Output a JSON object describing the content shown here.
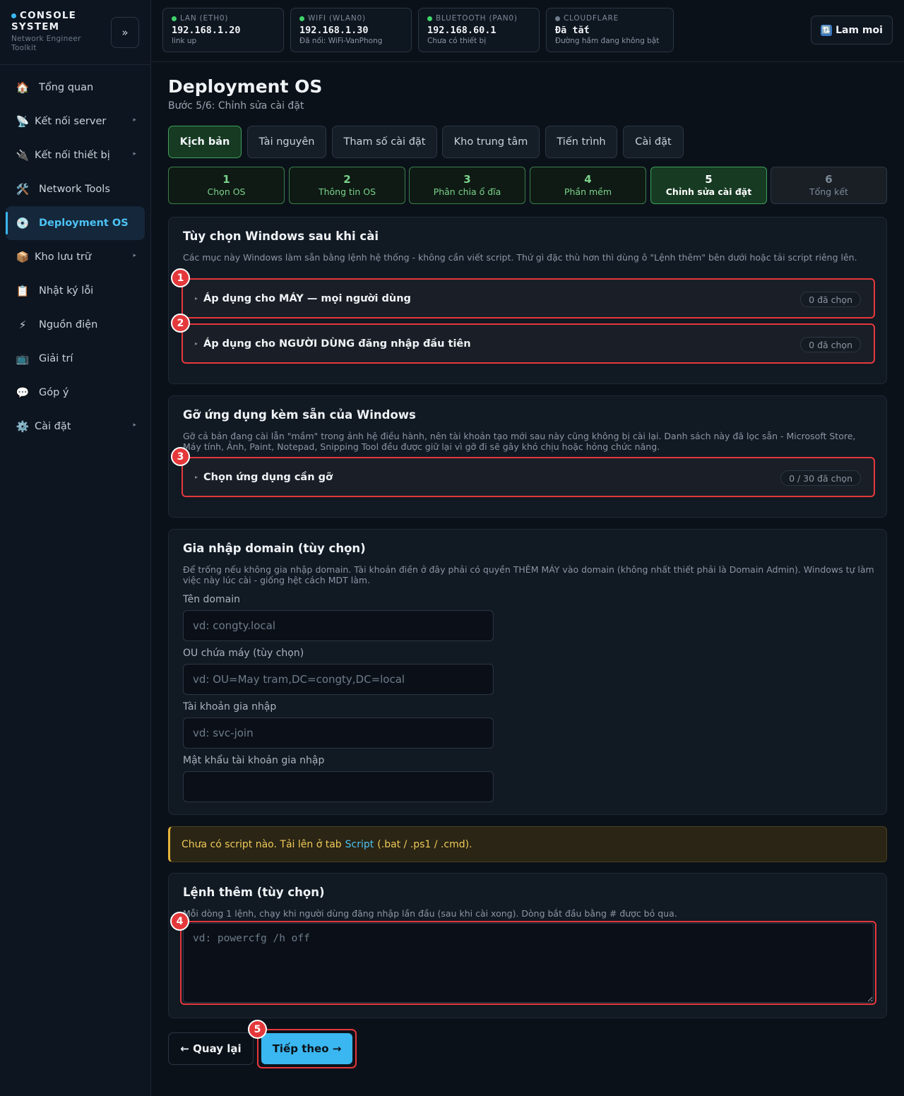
{
  "sidebar": {
    "brand_title": "CONSOLE SYSTEM",
    "brand_sub": "Network Engineer Toolkit",
    "collapse_icon": "»",
    "items": [
      {
        "label": "Tổng quan",
        "icon": "🏠"
      },
      {
        "label": "Kết nối server",
        "icon": "📡",
        "has_submenu": true
      },
      {
        "label": "Kết nối thiết bị",
        "icon": "🔌",
        "has_submenu": true
      },
      {
        "label": "Network Tools",
        "icon": "🛠️"
      },
      {
        "label": "Deployment OS",
        "icon": "💿",
        "active": true
      },
      {
        "label": "Kho lưu trữ",
        "icon": "📦",
        "has_submenu": true
      },
      {
        "label": "Nhật ký lỗi",
        "icon": "📋"
      },
      {
        "label": "Nguồn điện",
        "icon": "⚡"
      },
      {
        "label": "Giải trí",
        "icon": "📺"
      },
      {
        "label": "Góp ý",
        "icon": "💬"
      },
      {
        "label": "Cài đặt",
        "icon": "⚙️",
        "has_submenu": true
      }
    ]
  },
  "statusbar": [
    {
      "label": "LAN (ETH0)",
      "value": "192.168.1.20",
      "sub": "link up",
      "dot_color": "#3fd46b"
    },
    {
      "label": "WIFI (WLAN0)",
      "value": "192.168.1.30",
      "sub": "Đã nối: WiFi-VanPhong",
      "dot_color": "#3fd46b"
    },
    {
      "label": "BLUETOOTH (PAN0)",
      "value": "192.168.60.1",
      "sub": "Chưa có thiết bị",
      "dot_color": "#3fd46b"
    },
    {
      "label": "CLOUDFLARE",
      "value": "Đã tắt",
      "sub": "Đường hầm đang không bật",
      "dot_color": "#6d7b8a"
    }
  ],
  "refresh": {
    "label": "Lam moi",
    "icon": "🔃"
  },
  "page": {
    "title": "Deployment OS",
    "subtitle": "Bước 5/6: Chỉnh sửa cài đặt"
  },
  "tabs": [
    "Kịch bản",
    "Tài nguyên",
    "Tham số cài đặt",
    "Kho trung tâm",
    "Tiến trình",
    "Cài đặt"
  ],
  "steps": [
    {
      "n": "1",
      "label": "Chọn OS",
      "state": "done"
    },
    {
      "n": "2",
      "label": "Thông tin OS",
      "state": "done"
    },
    {
      "n": "3",
      "label": "Phân chia ổ đĩa",
      "state": "done"
    },
    {
      "n": "4",
      "label": "Phần mềm",
      "state": "done"
    },
    {
      "n": "5",
      "label": "Chỉnh sửa cài đặt",
      "state": "current"
    },
    {
      "n": "6",
      "label": "Tổng kết",
      "state": "pending"
    }
  ],
  "windows_options": {
    "title": "Tùy chọn Windows sau khi cài",
    "desc": "Các mục này Windows làm sẵn bằng lệnh hệ thống - không cần viết script. Thứ gì đặc thù hơn thì dùng ô \"Lệnh thêm\" bên dưới hoặc tải script riêng lên.",
    "machine": {
      "label": "Áp dụng cho MÁY — mọi người dùng",
      "badge": "0 đã chọn"
    },
    "user": {
      "label": "Áp dụng cho NGƯỜI DÙNG đăng nhập đầu tiên",
      "badge": "0 đã chọn"
    }
  },
  "remove_apps": {
    "title": "Gỡ ứng dụng kèm sẵn của Windows",
    "desc": "Gỡ cả bản đang cài lẫn \"mầm\" trong ảnh hệ điều hành, nên tài khoản tạo mới sau này cũng không bị cài lại. Danh sách này đã lọc sẵn - Microsoft Store, Máy tính, Ảnh, Paint, Notepad, Snipping Tool đều được giữ lại vì gỡ đi sẽ gây khó chịu hoặc hỏng chức năng.",
    "select": {
      "label": "Chọn ứng dụng cần gỡ",
      "badge": "0 / 30 đã chọn"
    }
  },
  "domain": {
    "title": "Gia nhập domain (tùy chọn)",
    "desc": "Để trống nếu không gia nhập domain. Tài khoản điền ở đây phải có quyền THÊM MÁY vào domain (không nhất thiết phải là Domain Admin). Windows tự làm việc này lúc cài - giống hệt cách MDT làm.",
    "domain_label": "Tên domain",
    "domain_placeholder": "vd: congty.local",
    "ou_label": "OU chứa máy (tùy chọn)",
    "ou_placeholder": "vd: OU=May tram,DC=congty,DC=local",
    "account_label": "Tài khoản gia nhập",
    "account_placeholder": "vd: svc-join",
    "password_label": "Mật khẩu tài khoản gia nhập",
    "password_value": ""
  },
  "warning": {
    "before": "Chưa có script nào. Tải lên ở tab",
    "link": "Script",
    "after": "(.bat / .ps1 / .cmd)."
  },
  "extra_cmds": {
    "title": "Lệnh thêm (tùy chọn)",
    "desc": "Mỗi dòng 1 lệnh, chạy khi người dùng đăng nhập lần đầu (sau khi cài xong). Dòng bắt đầu bằng # được bỏ qua.",
    "placeholder": "vd: powercfg /h off"
  },
  "nav_buttons": {
    "back": "← Quay lại",
    "next": "Tiếp theo →"
  },
  "markers": [
    "1",
    "2",
    "3",
    "4",
    "5"
  ]
}
